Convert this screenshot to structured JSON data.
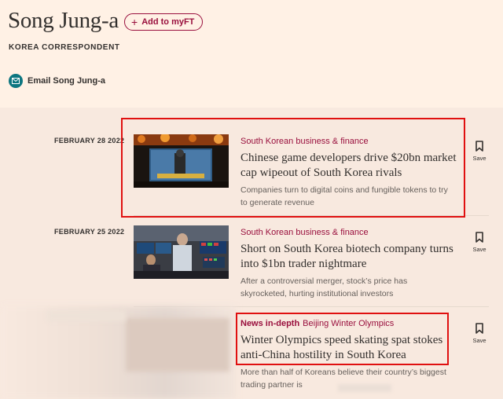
{
  "author": {
    "name": "Song Jung-a",
    "follow_label": "Add to myFT",
    "role": "KOREA CORRESPONDENT",
    "email_label": "Email Song Jung-a"
  },
  "save_label": "Save",
  "articles": [
    {
      "date": "FEBRUARY 28 2022",
      "tag": "South Korean business & finance",
      "headline": "Chinese game developers drive $20bn market cap wipeout of South Korea rivals",
      "standfirst": "Companies turn to digital coins and fungible tokens to try to generate revenue",
      "image_alt": "PUBG game art"
    },
    {
      "date": "FEBRUARY 25 2022",
      "tag": "South Korean business & finance",
      "headline": "Short on South Korea biotech company turns into $1bn trader nightmare",
      "standfirst": "After a controversial merger, stock’s price has skyrocketed, hurting institutional investors",
      "image_alt": "Trading floor"
    },
    {
      "date": "",
      "tag_prefix": "News in-depth",
      "tag": "Beijing Winter Olympics",
      "headline": "Winter Olympics speed skating spat stokes anti-China hostility in South Korea",
      "standfirst": "More than half of Koreans believe their country’s biggest trading partner is"
    }
  ],
  "colors": {
    "background": "#fff1e5",
    "feed_background": "#f8e9df",
    "accent": "#990f3d",
    "teal": "#0d7680",
    "highlight": "#e01010"
  }
}
